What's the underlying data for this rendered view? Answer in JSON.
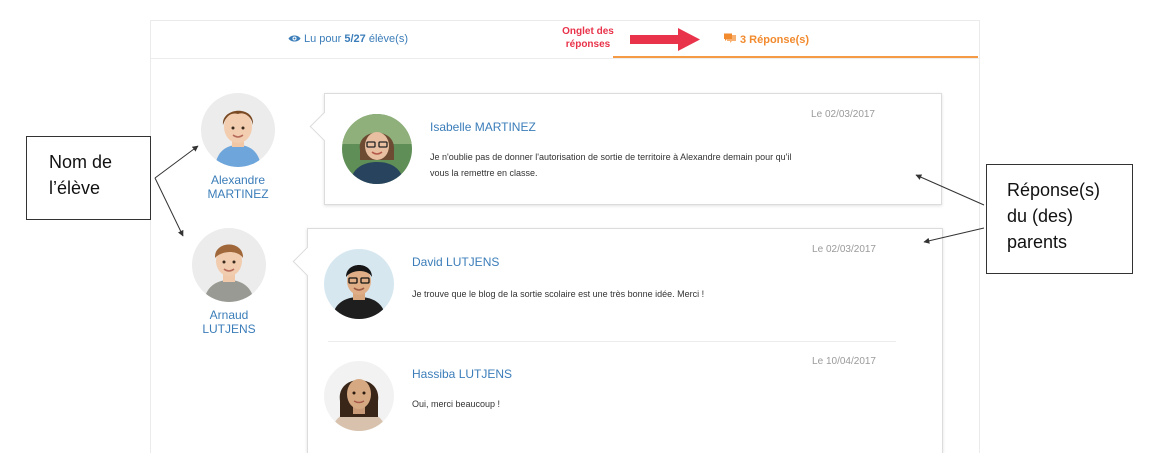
{
  "tabs": {
    "read_prefix": "Lu pour ",
    "read_count": "5/27",
    "read_suffix": " élève(s)",
    "replies_label": "3 Réponse(s)"
  },
  "threads": [
    {
      "student": {
        "first_name": "Alexandre",
        "last_name": "MARTINEZ"
      },
      "replies": [
        {
          "author": "Isabelle MARTINEZ",
          "date": "Le 02/03/2017",
          "text": "Je n'oublie pas de donner l'autorisation de sortie de territoire à Alexandre demain pour qu'il vous la remettre en classe."
        }
      ]
    },
    {
      "student": {
        "first_name": "Arnaud",
        "last_name": "LUTJENS"
      },
      "replies": [
        {
          "author": "David LUTJENS",
          "date": "Le 02/03/2017",
          "text": "Je trouve que le blog de la sortie scolaire est une très bonne idée. Merci !"
        },
        {
          "author": "Hassiba LUTJENS",
          "date": "Le 10/04/2017",
          "text": "Oui, merci beaucoup !"
        }
      ]
    }
  ],
  "annotations": {
    "tab_label_line1": "Onglet des",
    "tab_label_line2": "réponses",
    "student_name_line1": "Nom de",
    "student_name_line2": "l’élève",
    "parents_line1": "Réponse(s)",
    "parents_line2": "du (des)",
    "parents_line3": "parents"
  },
  "colors": {
    "link_blue": "#3b7db9",
    "tab_orange": "#f28a2e",
    "annotation_red": "#e8334a"
  }
}
